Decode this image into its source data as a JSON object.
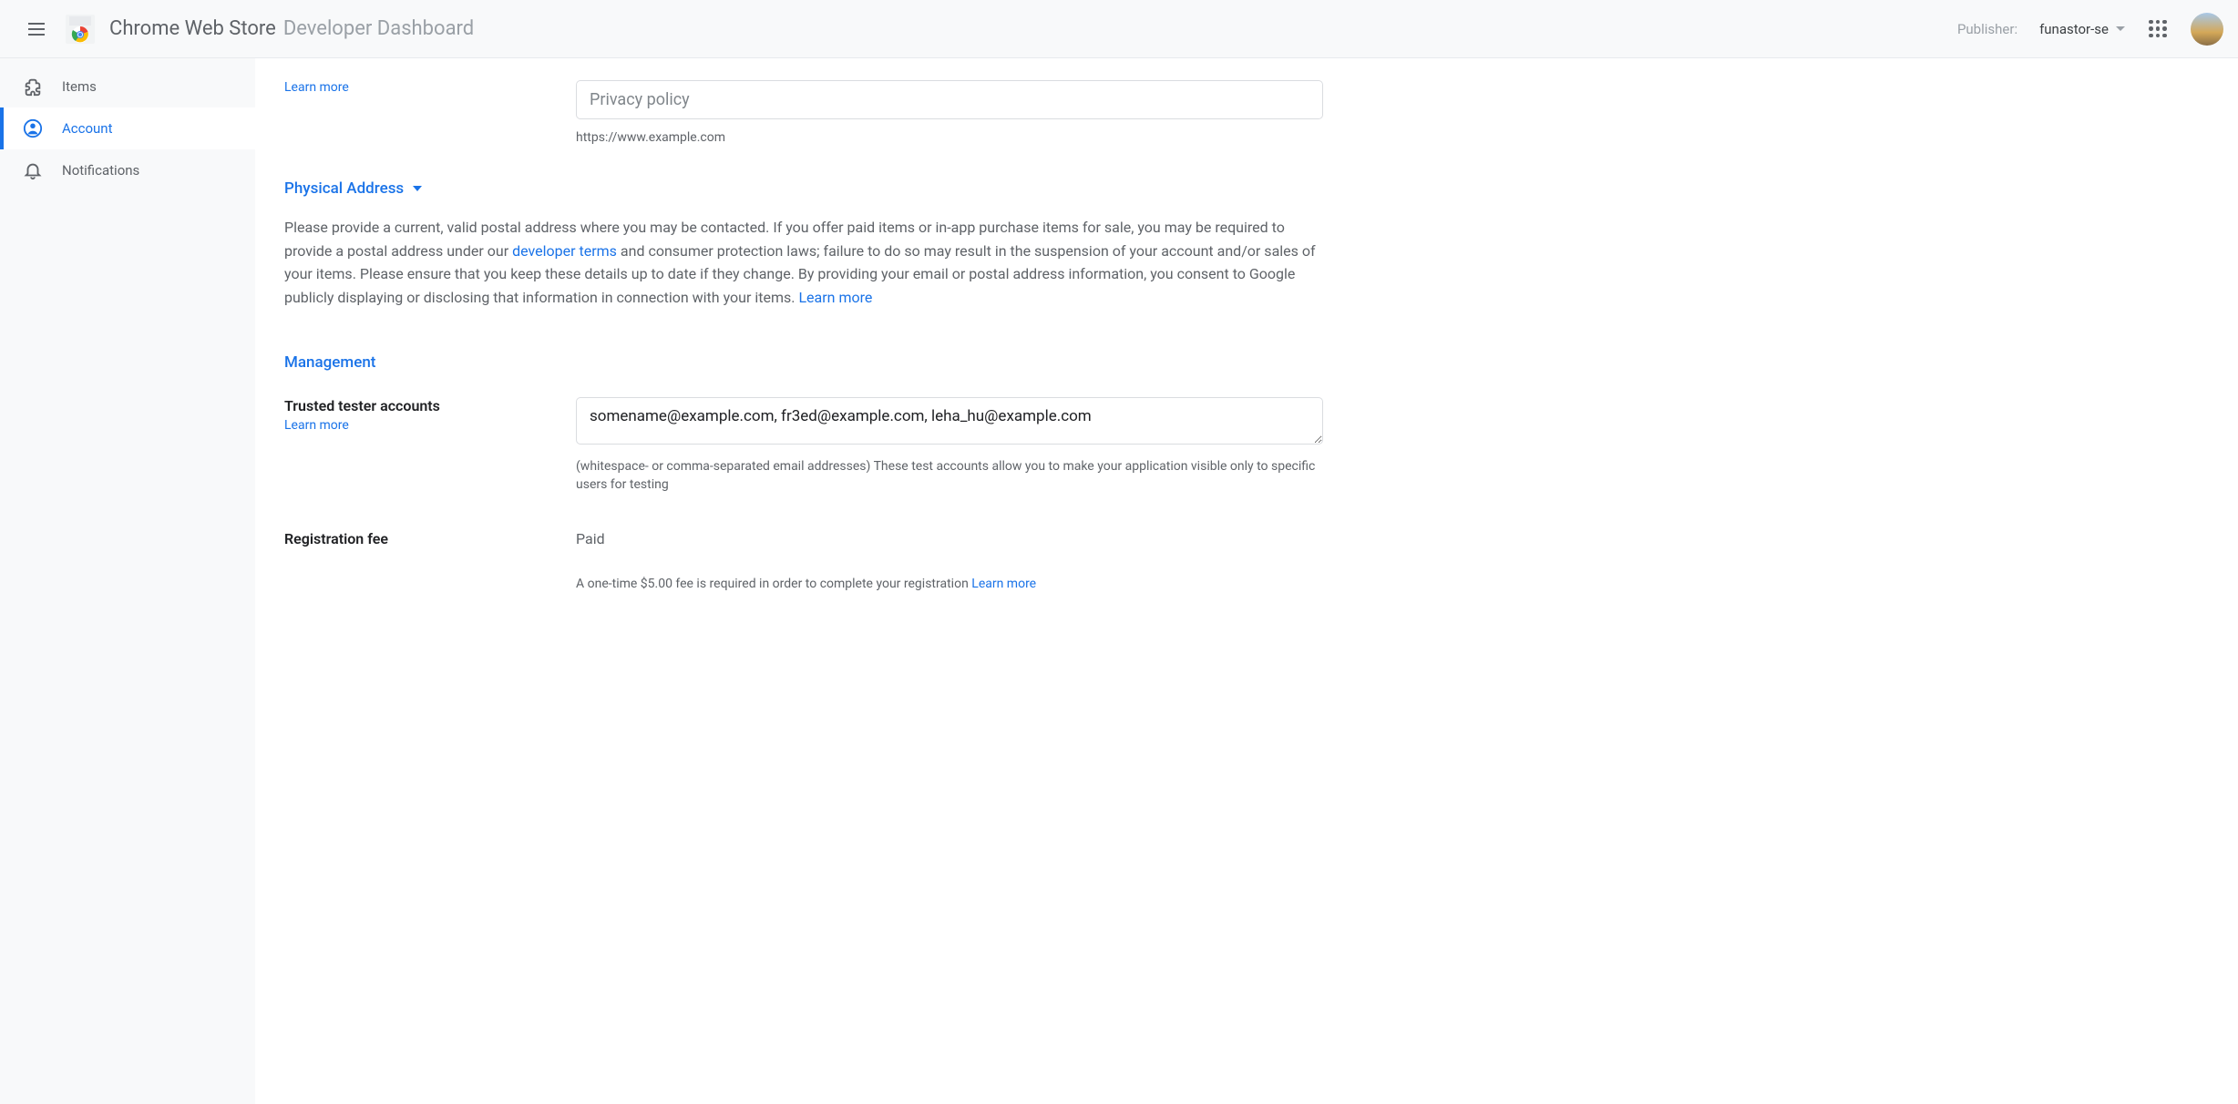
{
  "header": {
    "title_main": "Chrome Web Store",
    "title_sub": "Developer Dashboard",
    "publisher_label": "Publisher:",
    "publisher_selected": "funastor-se"
  },
  "sidebar": {
    "items": [
      {
        "label": "Items"
      },
      {
        "label": "Account"
      },
      {
        "label": "Notifications"
      }
    ]
  },
  "main": {
    "privacy_learn": "Learn more",
    "privacy_placeholder": "Privacy policy",
    "privacy_helper": "https://www.example.com",
    "physical_address_title": "Physical Address",
    "address_text_1": "Please provide a current, valid postal address where you may be contacted. If you offer paid items or in-app purchase items for sale, you may be required to provide a postal address under our ",
    "address_link_1": "developer terms",
    "address_text_2": " and consumer protection laws; failure to do so may result in the suspension of your account and/or sales of your items. Please ensure that you keep these details up to date if they change. By providing your email or postal address information, you consent to Google publicly displaying or disclosing that information in connection with your items. ",
    "address_link_2": "Learn more",
    "management_title": "Management",
    "trusted_label": "Trusted tester accounts",
    "trusted_learn": "Learn more",
    "trusted_value": "somename@example.com, fr3ed@example.com, leha_hu@example.com",
    "trusted_helper": "(whitespace- or comma-separated email addresses) These test accounts allow you to make your application visible only to specific users for testing",
    "reg_fee_label": "Registration fee",
    "reg_fee_value": "Paid",
    "reg_fee_note": "A one-time $5.00 fee is required in order to complete your registration ",
    "reg_fee_link": "Learn more"
  }
}
